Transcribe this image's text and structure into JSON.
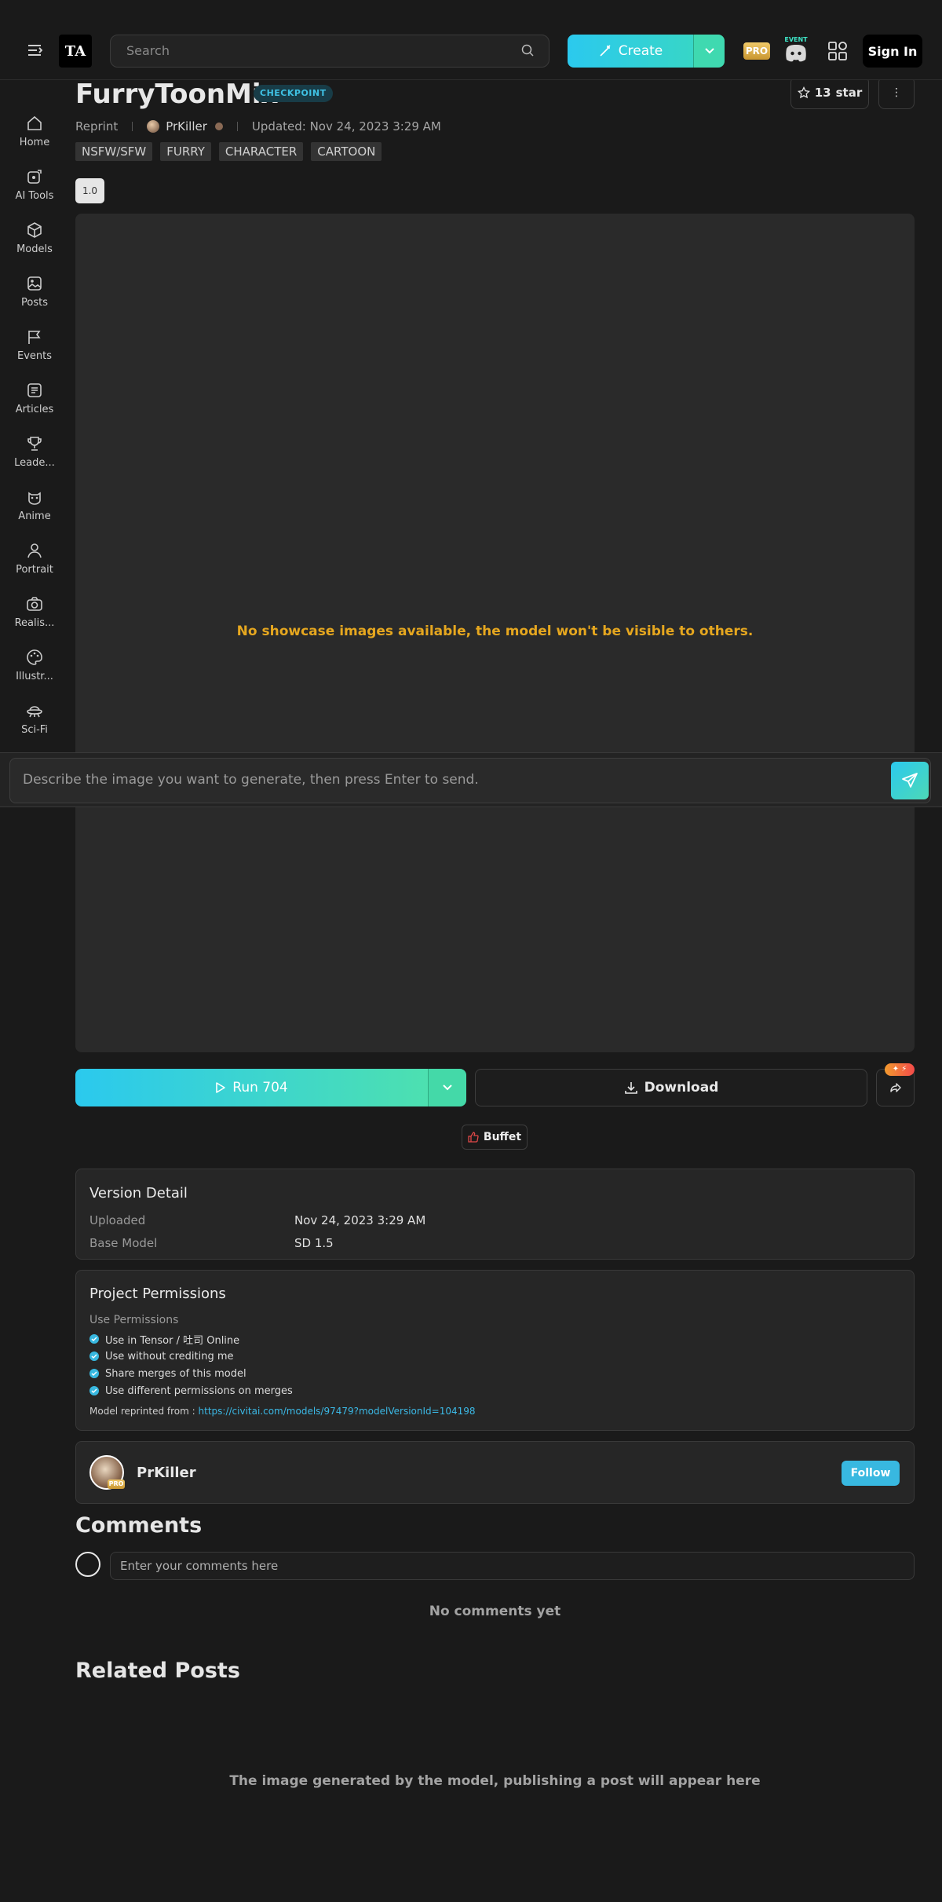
{
  "header": {
    "logo_text": "TA",
    "search_placeholder": "Search",
    "create_label": "Create",
    "pro_label": "PRO",
    "event_label": "EVENT",
    "signin_label": "Sign In",
    "accent_gradient": [
      "#2bc9ee",
      "#4de0b0"
    ]
  },
  "sidebar": {
    "items": [
      {
        "label": "Home",
        "icon": "home-icon"
      },
      {
        "label": "AI Tools",
        "icon": "ai-tools-icon"
      },
      {
        "label": "Models",
        "icon": "cube-icon"
      },
      {
        "label": "Posts",
        "icon": "image-icon"
      },
      {
        "label": "Events",
        "icon": "flag-icon"
      },
      {
        "label": "Articles",
        "icon": "article-icon"
      },
      {
        "label": "Leade...",
        "icon": "trophy-icon"
      },
      {
        "label": "Anime",
        "icon": "anime-icon"
      },
      {
        "label": "Portrait",
        "icon": "person-icon"
      },
      {
        "label": "Realis...",
        "icon": "camera-icon"
      },
      {
        "label": "Illustr...",
        "icon": "palette-icon"
      },
      {
        "label": "Sci-Fi",
        "icon": "ufo-icon"
      }
    ]
  },
  "model": {
    "title": "FurryToonMix",
    "type_badge": "CHECKPOINT",
    "star_count": "13",
    "star_label": "star",
    "source": "Reprint",
    "author": "PrKiller",
    "updated": "Updated: Nov 24, 2023 3:29 AM",
    "tags": [
      "NSFW/SFW",
      "FURRY",
      "CHARACTER",
      "CARTOON"
    ],
    "version": "1.0"
  },
  "showcase": {
    "empty_message": "No showcase images available, the model won't be visible to others."
  },
  "prompt": {
    "placeholder": "Describe the image you want to generate, then press Enter to send."
  },
  "actions": {
    "run_label": "Run 704",
    "download_label": "Download",
    "buffet_label": "Buffet"
  },
  "version_detail": {
    "title": "Version Detail",
    "rows": [
      {
        "label": "Uploaded",
        "value": "Nov 24, 2023 3:29 AM"
      },
      {
        "label": "Base Model",
        "value": "SD 1.5"
      }
    ]
  },
  "permissions": {
    "title": "Project Permissions",
    "subtitle": "Use Permissions",
    "items": [
      "Use in Tensor / 吐司 Online",
      "Use without crediting me",
      "Share merges of this model",
      "Use different permissions on merges"
    ],
    "reprint_label": "Model reprinted from :",
    "reprint_url": "https://civitai.com/models/97479?modelVersionId=104198"
  },
  "author_card": {
    "name": "PrKiller",
    "pro_label": "PRO",
    "follow_label": "Follow"
  },
  "comments": {
    "title": "Comments",
    "placeholder": "Enter your comments here",
    "empty": "No comments yet"
  },
  "related": {
    "title": "Related Posts",
    "empty": "The image generated by the model, publishing a post will appear here"
  }
}
